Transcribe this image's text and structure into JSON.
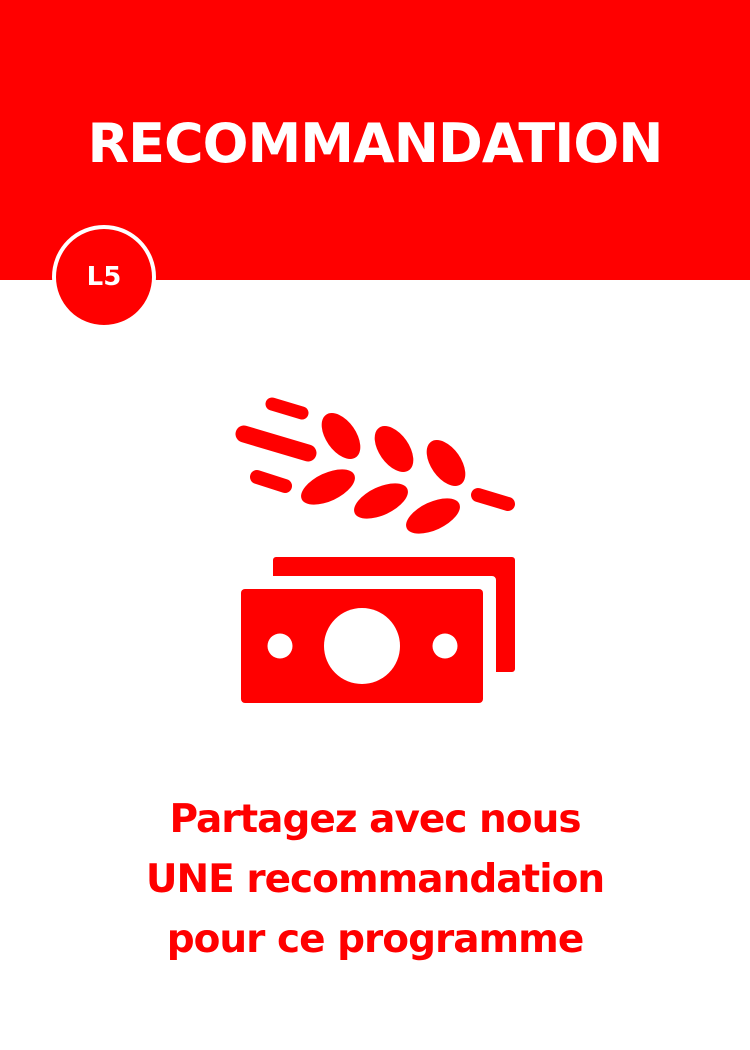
{
  "header": {
    "title": "RECOMMANDATION",
    "badge": "L5",
    "color": "#ff0000"
  },
  "icon": {
    "name": "wheat-money-icon"
  },
  "message": {
    "lines": [
      "Partagez avec nous",
      "UNE recommandation",
      "pour ce programme"
    ]
  }
}
